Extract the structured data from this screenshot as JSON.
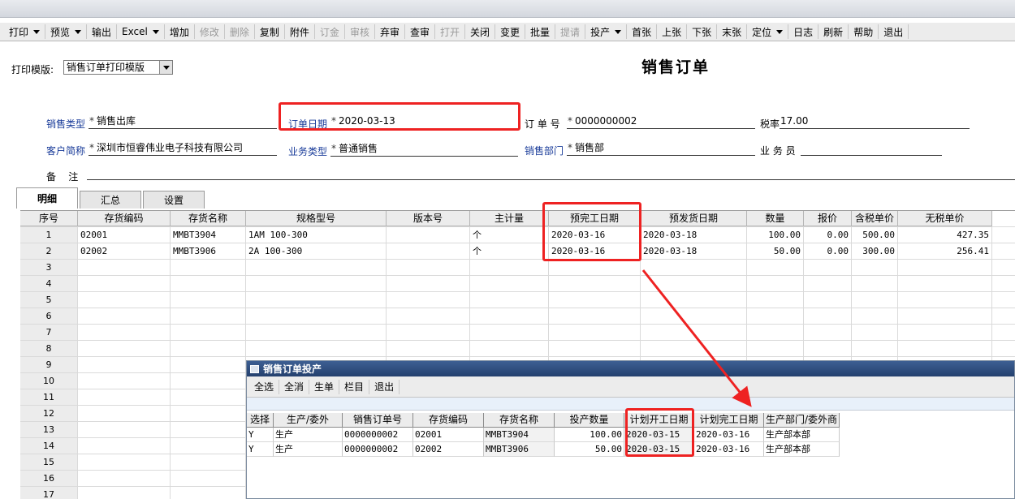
{
  "toolbar": {
    "items": [
      {
        "label": "打印",
        "dropdown": true,
        "enabled": true
      },
      {
        "label": "预览",
        "dropdown": true,
        "enabled": true
      },
      {
        "label": "输出",
        "dropdown": false,
        "enabled": true
      },
      {
        "label": "Excel",
        "dropdown": true,
        "enabled": true
      },
      {
        "label": "增加",
        "dropdown": false,
        "enabled": true
      },
      {
        "label": "修改",
        "dropdown": false,
        "enabled": false
      },
      {
        "label": "删除",
        "dropdown": false,
        "enabled": false
      },
      {
        "label": "复制",
        "dropdown": false,
        "enabled": true
      },
      {
        "label": "附件",
        "dropdown": false,
        "enabled": true
      },
      {
        "label": "订金",
        "dropdown": false,
        "enabled": false
      },
      {
        "label": "审核",
        "dropdown": false,
        "enabled": false
      },
      {
        "label": "弃审",
        "dropdown": false,
        "enabled": true
      },
      {
        "label": "查审",
        "dropdown": false,
        "enabled": true
      },
      {
        "label": "打开",
        "dropdown": false,
        "enabled": false
      },
      {
        "label": "关闭",
        "dropdown": false,
        "enabled": true
      },
      {
        "label": "变更",
        "dropdown": false,
        "enabled": true
      },
      {
        "label": "批量",
        "dropdown": false,
        "enabled": true
      },
      {
        "label": "提请",
        "dropdown": false,
        "enabled": false
      },
      {
        "label": "投产",
        "dropdown": true,
        "enabled": true
      },
      {
        "label": "首张",
        "dropdown": false,
        "enabled": true
      },
      {
        "label": "上张",
        "dropdown": false,
        "enabled": true
      },
      {
        "label": "下张",
        "dropdown": false,
        "enabled": true
      },
      {
        "label": "末张",
        "dropdown": false,
        "enabled": true
      },
      {
        "label": "定位",
        "dropdown": true,
        "enabled": true
      },
      {
        "label": "日志",
        "dropdown": false,
        "enabled": true
      },
      {
        "label": "刷新",
        "dropdown": false,
        "enabled": true
      },
      {
        "label": "帮助",
        "dropdown": false,
        "enabled": true
      },
      {
        "label": "退出",
        "dropdown": false,
        "enabled": true
      }
    ]
  },
  "template": {
    "label": "打印模版:",
    "value": "销售订单打印模版"
  },
  "doc_title": "销售订单",
  "header": {
    "sale_type": {
      "label": "销售类型",
      "value": "销售出库"
    },
    "order_date": {
      "label": "订单日期",
      "value": "2020-03-13"
    },
    "order_no": {
      "label": "订 单 号",
      "value": "0000000002"
    },
    "tax_rate": {
      "label": "税率",
      "value": "17.00"
    },
    "customer": {
      "label": "客户简称",
      "value": "深圳市恒睿伟业电子科技有限公司"
    },
    "biz_type": {
      "label": "业务类型",
      "value": "普通销售"
    },
    "sales_dept": {
      "label": "销售部门",
      "value": "销售部"
    },
    "salesman": {
      "label": "业 务 员",
      "value": ""
    },
    "remark": {
      "label": "备    注",
      "value": ""
    }
  },
  "star": "*",
  "tabs": [
    "明细",
    "汇总",
    "设置"
  ],
  "grid": {
    "columns": [
      "序号",
      "存货编码",
      "存货名称",
      "规格型号",
      "版本号",
      "主计量",
      "预完工日期",
      "预发货日期",
      "数量",
      "报价",
      "含税单价",
      "无税单价"
    ],
    "rows": [
      [
        "1",
        "02001",
        "MMBT3904",
        "1AM 100-300",
        "",
        "个",
        "2020-03-16",
        "2020-03-18",
        "100.00",
        "0.00",
        "500.00",
        "427.35"
      ],
      [
        "2",
        "02002",
        "MMBT3906",
        "2A 100-300",
        "",
        "个",
        "2020-03-16",
        "2020-03-18",
        "50.00",
        "0.00",
        "300.00",
        "256.41"
      ],
      [
        "3",
        "",
        "",
        "",
        "",
        "",
        "",
        "",
        "",
        "",
        "",
        ""
      ],
      [
        "4",
        "",
        "",
        "",
        "",
        "",
        "",
        "",
        "",
        "",
        "",
        ""
      ],
      [
        "5",
        "",
        "",
        "",
        "",
        "",
        "",
        "",
        "",
        "",
        "",
        ""
      ],
      [
        "6",
        "",
        "",
        "",
        "",
        "",
        "",
        "",
        "",
        "",
        "",
        ""
      ],
      [
        "7",
        "",
        "",
        "",
        "",
        "",
        "",
        "",
        "",
        "",
        "",
        ""
      ],
      [
        "8",
        "",
        "",
        "",
        "",
        "",
        "",
        "",
        "",
        "",
        "",
        ""
      ],
      [
        "9",
        "",
        "",
        "",
        "",
        "",
        "",
        "",
        "",
        "",
        "",
        ""
      ],
      [
        "10",
        "",
        "",
        "",
        "",
        "",
        "",
        "",
        "",
        "",
        "",
        ""
      ],
      [
        "11",
        "",
        "",
        "",
        "",
        "",
        "",
        "",
        "",
        "",
        "",
        ""
      ],
      [
        "12",
        "",
        "",
        "",
        "",
        "",
        "",
        "",
        "",
        "",
        "",
        ""
      ],
      [
        "13",
        "",
        "",
        "",
        "",
        "",
        "",
        "",
        "",
        "",
        "",
        ""
      ],
      [
        "14",
        "",
        "",
        "",
        "",
        "",
        "",
        "",
        "",
        "",
        "",
        ""
      ],
      [
        "15",
        "",
        "",
        "",
        "",
        "",
        "",
        "",
        "",
        "",
        "",
        ""
      ],
      [
        "16",
        "",
        "",
        "",
        "",
        "",
        "",
        "",
        "",
        "",
        "",
        ""
      ],
      [
        "17",
        "",
        "",
        "",
        "",
        "",
        "",
        "",
        "",
        "",
        "",
        ""
      ]
    ]
  },
  "popup": {
    "title": "销售订单投产",
    "toolbar": [
      "全选",
      "全消",
      "生单",
      "栏目",
      "退出"
    ],
    "columns": [
      "选择",
      "生产/委外",
      "销售订单号",
      "存货编码",
      "存货名称",
      "投产数量",
      "计划开工日期",
      "计划完工日期",
      "生产部门/委外商"
    ],
    "rows": [
      [
        "Y",
        "生产",
        "0000000002",
        "02001",
        "MMBT3904",
        "100.00",
        "2020-03-15",
        "2020-03-16",
        "生产部本部"
      ],
      [
        "Y",
        "生产",
        "0000000002",
        "02002",
        "MMBT3906",
        "50.00",
        "2020-03-15",
        "2020-03-16",
        "生产部本部"
      ]
    ]
  },
  "colors": {
    "highlight": "#ee2222",
    "label_blue": "#1a3c9a",
    "popup_title": "#2c4a7c"
  }
}
